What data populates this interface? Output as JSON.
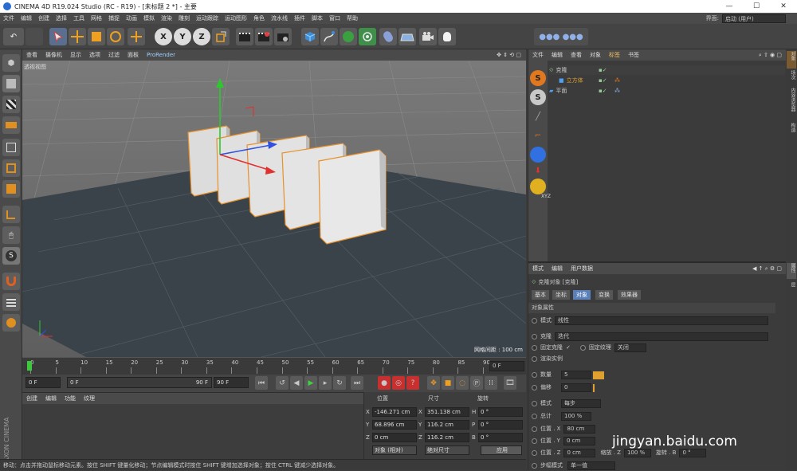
{
  "window": {
    "title": "CINEMA 4D R19.024 Studio (RC - R19) - [未标题 2 *] - 主要",
    "minimize": "—",
    "maximize": "☐",
    "close": "✕"
  },
  "menubar": {
    "items": [
      "文件",
      "编辑",
      "创建",
      "选择",
      "工具",
      "网格",
      "捕捉",
      "动画",
      "模拟",
      "渲染",
      "雕刻",
      "运动跟踪",
      "运动图形",
      "角色",
      "流水线",
      "插件",
      "脚本",
      "窗口",
      "帮助"
    ],
    "layout_label": "界面:",
    "layout_value": "启动 (用户)"
  },
  "toolbar": {
    "undo_icon": "undo-icon",
    "axis_x": "X",
    "axis_y": "Y",
    "axis_z": "Z"
  },
  "viewport": {
    "menu": [
      "查看",
      "摄像机",
      "显示",
      "选项",
      "过滤",
      "面板",
      "ProRender"
    ],
    "label": "透视视图",
    "grid_info": "网格间距 : 100 cm"
  },
  "timeline": {
    "ticks": [
      "0",
      "5",
      "10",
      "15",
      "20",
      "25",
      "30",
      "35",
      "40",
      "45",
      "50",
      "55",
      "60",
      "65",
      "70",
      "75",
      "80",
      "85",
      "90"
    ],
    "current_frame": "0 F"
  },
  "playback": {
    "start_field": "0 F",
    "slider_start": "0 F",
    "slider_end": "90 F",
    "end_field": "90 F"
  },
  "material_panel": {
    "menu": [
      "创建",
      "编辑",
      "功能",
      "纹理"
    ]
  },
  "coord_panel": {
    "headers": [
      "位置",
      "尺寸",
      "旋转"
    ],
    "rows": [
      {
        "axis": "X",
        "pos": "-146.271 cm",
        "size_axis": "X",
        "size": "351.138 cm",
        "rot_axis": "H",
        "rot": "0 °"
      },
      {
        "axis": "Y",
        "pos": "68.896 cm",
        "size_axis": "Y",
        "size": "116.2 cm",
        "rot_axis": "P",
        "rot": "0 °"
      },
      {
        "axis": "Z",
        "pos": "0 cm",
        "size_axis": "Z",
        "size": "116.2 cm",
        "rot_axis": "B",
        "rot": "0 °"
      }
    ],
    "mode_select": "对象 (相对)",
    "size_select": "绝对尺寸",
    "apply_button": "应用"
  },
  "status": "移动：点击并拖动鼠标移动元素。按住 SHIFT 键量化移动；节点编辑模式时按住 SHIFT 键增加选择对象；按住 CTRL 键减少选择对象。",
  "object_manager": {
    "menu": [
      "文件",
      "编辑",
      "查看",
      "对象",
      "标签",
      "书签"
    ],
    "objects": [
      {
        "name": "克隆",
        "color": "#c8c8c8"
      },
      {
        "name": "立方体",
        "color": "#e0a030"
      },
      {
        "name": "平面",
        "color": "#c8c8c8"
      }
    ]
  },
  "attribute_manager": {
    "menu": [
      "模式",
      "编辑",
      "用户数据"
    ],
    "object_title": "克隆对象 [克隆]",
    "tabs": [
      "基本",
      "坐标",
      "对象",
      "变换",
      "效果器"
    ],
    "active_tab": "对象",
    "section": "对象属性",
    "mode_label": "模式",
    "mode_value": "线性",
    "clone_label": "克隆",
    "clone_value": "迭代",
    "fix_clone_label": "固定克隆",
    "fix_clone_check": "✓",
    "fix_texture_label": "固定纹理",
    "fix_texture_value": "关闭",
    "render_instance_label": "渲染实例",
    "count_label": "数量",
    "count_value": "5",
    "offset_label": "偏移",
    "offset_value": "0",
    "mode2_label": "模式",
    "mode2_value": "每步",
    "total_label": "总计",
    "total_value": "100 %",
    "pos_x_label": "位置 . X",
    "pos_x_value": "80 cm",
    "pos_y_label": "位置 . Y",
    "pos_y_value": "0 cm",
    "pos_z_label": "位置 . Z",
    "pos_z_value": "0 cm",
    "scale_z_label": "缩放 . Z",
    "scale_z_value": "100 %",
    "rot_b_label": "旋转 . B",
    "rot_b_value": "0 °",
    "step_mode_label": "步幅模式",
    "step_mode_value": "单一值"
  },
  "side_tabs": [
    "对象",
    "场次",
    "内容浏览器",
    "构造",
    "属性",
    "层"
  ],
  "maxon_logo": "MAXON CINEMA 4D",
  "watermark": "jingyan.baidu.com"
}
